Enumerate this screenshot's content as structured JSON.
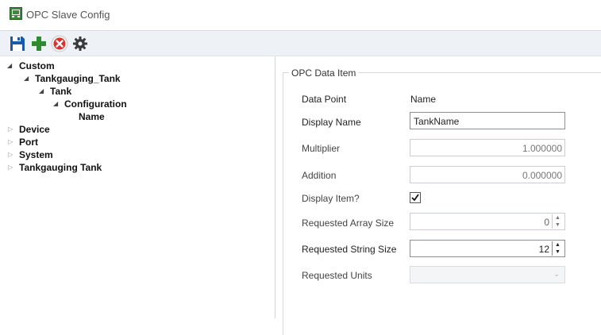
{
  "window": {
    "title": "OPC Slave Config",
    "icon": "app-config-icon"
  },
  "toolbar": {
    "buttons": [
      {
        "name": "save-icon",
        "color": "#1a5aa6"
      },
      {
        "name": "add-icon",
        "color": "#2e8b2e"
      },
      {
        "name": "delete-icon",
        "color": "#d9312b"
      },
      {
        "name": "gear-icon",
        "color": "#3a3a3a"
      }
    ]
  },
  "tree": {
    "nodes": [
      {
        "label": "Custom",
        "expanded": true
      },
      {
        "label": "Tankgauging_Tank",
        "expanded": true
      },
      {
        "label": "Tank",
        "expanded": true
      },
      {
        "label": "Configuration",
        "expanded": true
      },
      {
        "label": "Name",
        "selected": true
      },
      {
        "label": "Device",
        "expanded": false
      },
      {
        "label": "Port",
        "expanded": false
      },
      {
        "label": "System",
        "expanded": false
      },
      {
        "label": "Tankgauging Tank",
        "expanded": false
      }
    ]
  },
  "panel": {
    "group_title": "OPC Data Item",
    "data_point": {
      "label": "Data Point",
      "value": "Name"
    },
    "display_name": {
      "label": "Display Name",
      "value": "TankName"
    },
    "multiplier": {
      "label": "Multiplier",
      "value": "1.000000"
    },
    "addition": {
      "label": "Addition",
      "value": "0.000000"
    },
    "display_item": {
      "label": "Display Item?",
      "checked": true
    },
    "array_size": {
      "label": "Requested Array Size",
      "value": "0"
    },
    "string_size": {
      "label": "Requested String Size",
      "value": "12"
    },
    "units": {
      "label": "Requested Units",
      "value": ""
    }
  }
}
